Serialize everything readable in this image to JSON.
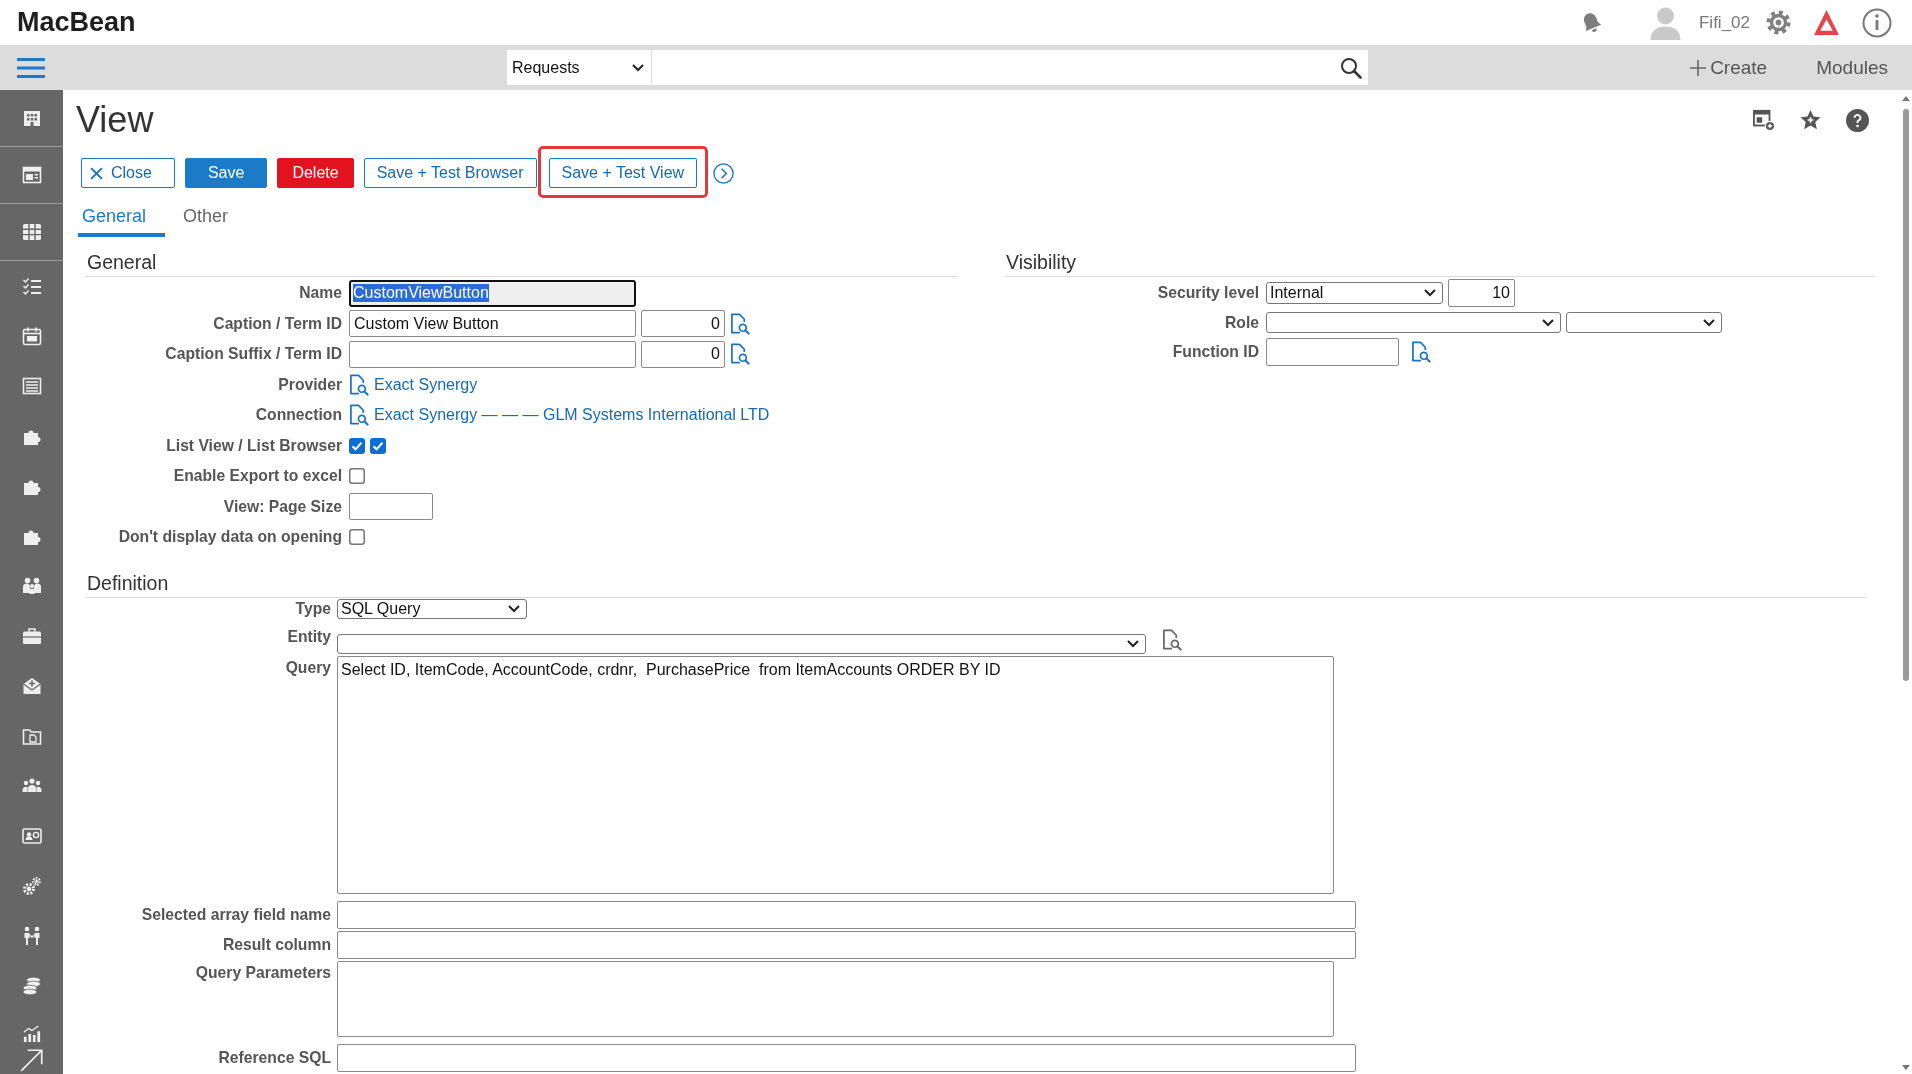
{
  "header": {
    "logo": "MacBean",
    "user": "Fifi_02"
  },
  "navbar": {
    "search_scope": "Requests",
    "create": "Create",
    "modules": "Modules"
  },
  "page": {
    "title": "View"
  },
  "toolbar": {
    "buttons": [
      {
        "label": "Close",
        "kind": "close",
        "highlighted": false
      },
      {
        "label": "Save",
        "kind": "save",
        "highlighted": false
      },
      {
        "label": "Delete",
        "kind": "delete",
        "highlighted": false
      },
      {
        "label": "Save + Test Browser",
        "kind": "save_test",
        "highlighted": false
      },
      {
        "label": "Save + Test View",
        "kind": "save_test",
        "highlighted": true
      }
    ]
  },
  "tabs": [
    {
      "label": "General",
      "selected": true
    },
    {
      "label": "Other",
      "selected": false
    }
  ],
  "general": {
    "heading": "General",
    "rows": [
      {
        "label": "Name",
        "kind": "text",
        "value": "CustomViewButton",
        "focused": true
      },
      {
        "label": "Caption / Term ID",
        "kind": "text_term",
        "value": "Custom View Button",
        "term": "0",
        "focused": false
      },
      {
        "label": "Caption Suffix / Term ID",
        "kind": "text_term",
        "term": "0",
        "focused": false
      },
      {
        "label": "Provider",
        "kind": "link",
        "value": "Exact Synergy"
      },
      {
        "label": "Connection",
        "kind": "link",
        "value": "Exact Synergy — — — GLM Systems International LTD"
      },
      {
        "label": "List View / List Browser",
        "kind": "checkboxes",
        "boxes": [
          {
            "checked": true
          },
          {
            "checked": true
          }
        ]
      },
      {
        "label": "Enable Export to excel",
        "kind": "checkbox",
        "checked": false
      },
      {
        "label": "View: Page Size",
        "kind": "short_text"
      },
      {
        "label": "Don't display data on opening",
        "kind": "checkbox",
        "checked": false
      }
    ]
  },
  "visibility": {
    "heading": "Visibility",
    "rows": [
      {
        "label": "Security level",
        "kind": "select_number",
        "value": "Internal",
        "number": "10"
      },
      {
        "label": "Role",
        "kind": "two_selects"
      },
      {
        "label": "Function ID",
        "kind": "lookup"
      }
    ]
  },
  "definition": {
    "heading": "Definition",
    "rows": [
      {
        "label": "Type",
        "kind": "select",
        "value": "SQL Query"
      },
      {
        "label": "Entity",
        "kind": "wide_select"
      },
      {
        "label": "Query",
        "kind": "large_textarea",
        "value": "Select ID, ItemCode, AccountCode, crdnr,  PurchasePrice  from ItemAccounts ORDER BY ID"
      },
      {
        "label": "Selected array field name",
        "kind": "text"
      },
      {
        "label": "Result column",
        "kind": "text"
      },
      {
        "label": "Query Parameters",
        "kind": "textarea"
      },
      {
        "label": "Reference SQL",
        "kind": "text"
      }
    ]
  }
}
